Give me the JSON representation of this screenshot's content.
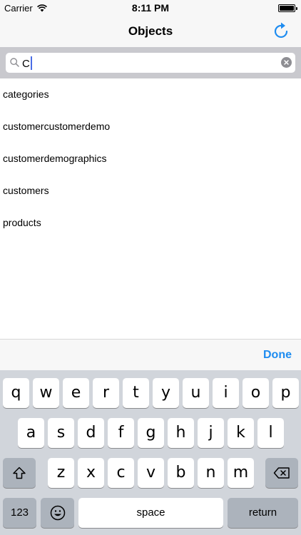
{
  "status": {
    "carrier": "Carrier",
    "time": "8:11 PM",
    "battery_level": 1.0
  },
  "nav": {
    "title": "Objects",
    "refresh_icon": "refresh-icon"
  },
  "search": {
    "value": "C",
    "placeholder": ""
  },
  "results": [
    "categories",
    "customercustomerdemo",
    "customerdemographics",
    "customers",
    "products"
  ],
  "accessory": {
    "done_label": "Done"
  },
  "keyboard": {
    "row1": [
      "q",
      "w",
      "e",
      "r",
      "t",
      "y",
      "u",
      "i",
      "o",
      "p"
    ],
    "row2": [
      "a",
      "s",
      "d",
      "f",
      "g",
      "h",
      "j",
      "k",
      "l"
    ],
    "row3": [
      "z",
      "x",
      "c",
      "v",
      "b",
      "n",
      "m"
    ],
    "numbers_label": "123",
    "space_label": "space",
    "return_label": "return"
  },
  "colors": {
    "accent": "#1e8cf0",
    "cursor": "#4a6de5",
    "keyboard_bg": "#d1d5db"
  }
}
